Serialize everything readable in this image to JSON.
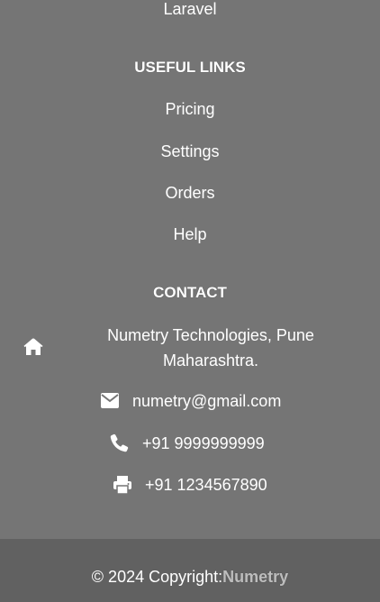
{
  "framework_links": {
    "last_item": "Laravel"
  },
  "useful_links": {
    "heading": "USEFUL LINKS",
    "items": [
      "Pricing",
      "Settings",
      "Orders",
      "Help"
    ]
  },
  "contact": {
    "heading": "CONTACT",
    "address_line1": "Numetry Technologies, Pune",
    "address_line2": "Maharashtra.",
    "email": "numetry@gmail.com",
    "phone": "+91 9999999999",
    "fax": "+91 1234567890",
    "icons": [
      "home-icon",
      "envelope-icon",
      "phone-icon",
      "printer-icon"
    ]
  },
  "copyright": {
    "prefix": "© 2024 Copyright:",
    "brand": "Numetry"
  },
  "colors": {
    "footer_background": "#757575",
    "bottom_bar_background": "#616161",
    "text": "#ffffff",
    "brand": "#bdbdbd"
  }
}
